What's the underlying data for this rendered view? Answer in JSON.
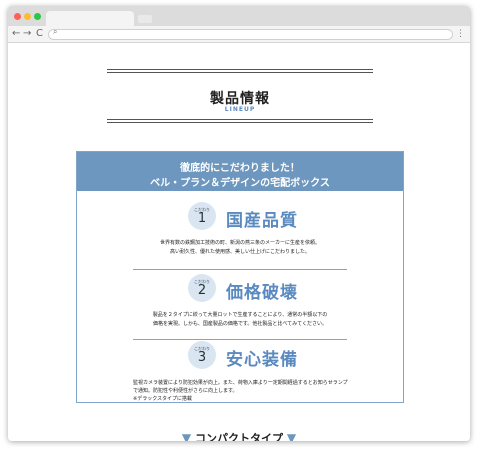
{
  "browser": {
    "nav": {
      "back": "←",
      "forward": "→",
      "reload": "C"
    },
    "search_icon": "search-icon",
    "menu_icon": "⋮"
  },
  "page": {
    "title": "製品情報",
    "subtitle": "LINEUP",
    "banner_line1": "徹底的にこだわりました！",
    "banner_line2": "ベル・プラン＆デザインの宅配ボックス",
    "features": [
      {
        "badge_label": "こだわり",
        "number": "1",
        "title": "国産品質",
        "lines": [
          "世界有数の鉄鋼加工技術の町、新潟の燕三条のメーカーに生産を依頼。",
          "高い耐久性、優れた使用感、美しい仕上げにこだわりました。"
        ]
      },
      {
        "badge_label": "こだわり",
        "number": "2",
        "title": "価格破壊",
        "lines": [
          "製品を２タイプに絞って大量ロットで生産することにより、通常の半額以下の",
          "価格を実現。しかも、国産製品の価格です。他社製品と比べてみてください。"
        ]
      },
      {
        "badge_label": "こだわり",
        "number": "3",
        "title": "安心装備",
        "lines": [
          "監視カメラ装置により防犯効果が向上。また、荷物入庫より一定期間経過するとお知らせランプ",
          "で通知。防犯性や利便性がさらに向上します。",
          "※デラックスタイプに搭載"
        ]
      }
    ],
    "bottom_heading": "コンパクトタイプ",
    "bottom_arrow": "▼"
  }
}
